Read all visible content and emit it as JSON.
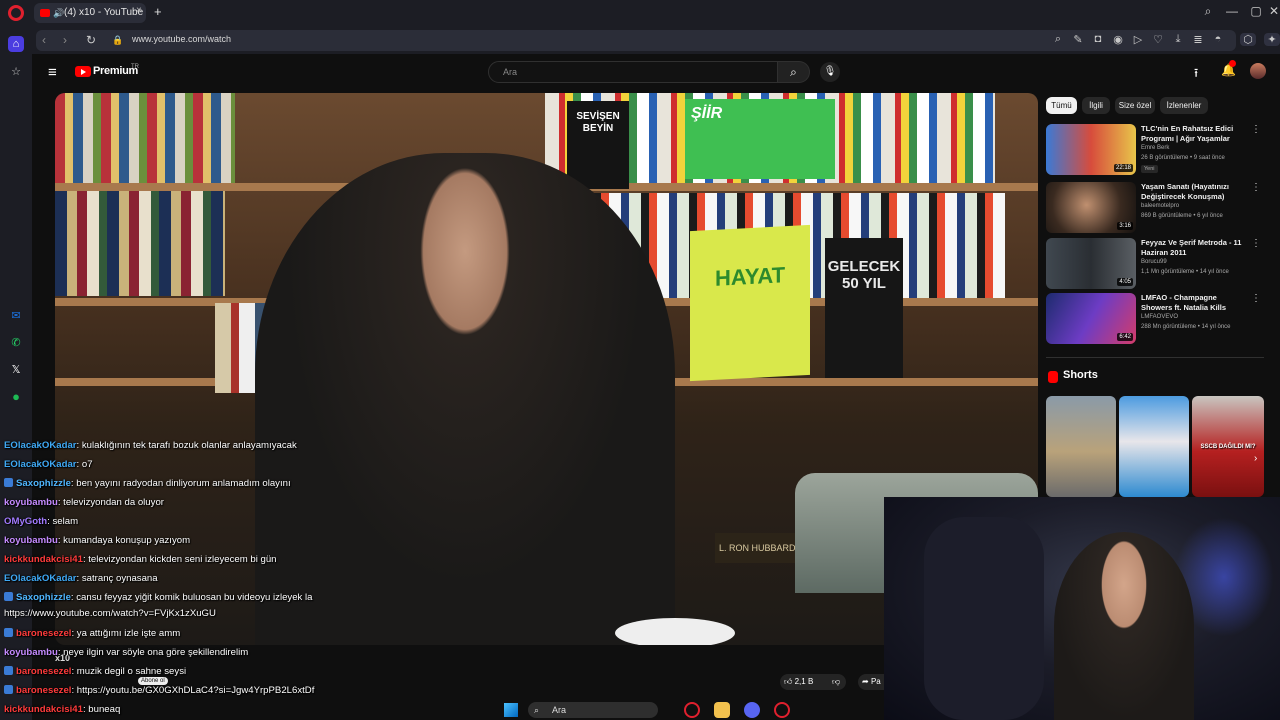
{
  "browser": {
    "tab_title": "(4) x10 - YouTube",
    "tab_audio_icon": "speaker-icon",
    "tab_close": "×",
    "new_tab": "+",
    "url": "www.youtube.com/watch",
    "window_controls": {
      "search": "⌕",
      "minimize": "—",
      "maximize": "▢",
      "close": "✕"
    }
  },
  "youtube": {
    "menu_glyph": "≡",
    "logo_text": "Premium",
    "logo_region": "TR",
    "search_placeholder": "Ara",
    "filter_chips": [
      "Tümü",
      "İlgili",
      "Size özel",
      "İzlenenler"
    ],
    "recommendations": [
      {
        "title": "TLC'nin En Rahatsız Edici Programı | Ağır Yaşamlar",
        "channel": "Emre Berk",
        "meta": "26 B görüntüleme • 9 saat önce",
        "badge": "Yeni",
        "duration": "22:18"
      },
      {
        "title": "Yaşam Sanatı (Hayatınızı Değiştirecek Konuşma)",
        "channel": "baleemotelpro",
        "meta": "869 B görüntüleme • 6 yıl önce",
        "duration": "3:16"
      },
      {
        "title": "Feyyaz Ve Şerif Metroda - 11 Haziran 2011",
        "channel": "Borucu99",
        "meta": "1,1 Mn görüntüleme • 14 yıl önce",
        "duration": "4:05"
      },
      {
        "title": "LMFAO - Champagne Showers ft. Natalia Kills",
        "channel": "LMFAOVEVO",
        "meta": "288 Mn görüntüleme • 14 yıl önce",
        "duration": "6:42"
      }
    ],
    "shorts_label": "Shorts",
    "shorts_items": [
      "short-1",
      "short-2",
      "short-3"
    ],
    "short_3_caption": "SSCB DAĞILDI MI?",
    "channel_name": "x10",
    "subscribe": "Abone ol",
    "like_count": "2,1 B",
    "share_label": "Pa"
  },
  "book_titles": {
    "b1": "SEVİŞEN BEYİN",
    "b2": "HAYAT",
    "b3": "GELECEK 50 YIL",
    "b4": "ŞİİR",
    "b5": "L. RON HUBBARD"
  },
  "chat": [
    {
      "user": "EOlacakOKadar",
      "text": ": kulaklığının tek tarafı bozuk olanlar anlayamıyacak",
      "color": "#3fa9f5",
      "platform": "none"
    },
    {
      "user": "EOlacakOKadar",
      "text": ": o7",
      "color": "#3fa9f5",
      "platform": "none"
    },
    {
      "user": "Saxophizzle",
      "text": ": ben yayını radyodan dinliyorum anlamadım olayını",
      "color": "#4fb6ff",
      "platform": "#3a7bd5"
    },
    {
      "user": "koyubambu",
      "text": ": televizyondan da oluyor",
      "color": "#c58bff",
      "platform": "none"
    },
    {
      "user": "OMyGoth",
      "text": ": selam",
      "color": "#a27bff",
      "platform": "none"
    },
    {
      "user": "koyubambu",
      "text": ": kumandaya konuşup yazıyom",
      "color": "#c58bff",
      "platform": "none"
    },
    {
      "user": "kickkundakcisi41",
      "text": ": televizyondan kickden seni izleyecem bi gün",
      "color": "#ff3b3b",
      "platform": "none"
    },
    {
      "user": "EOlacakOKadar",
      "text": ": satranç oynasana",
      "color": "#3fa9f5",
      "platform": "none"
    },
    {
      "user": "Saxophizzle",
      "text": ": cansu feyyaz yiğit komik buluosan bu videoyu izleyek la",
      "color": "#4fb6ff",
      "platform": "#3a7bd5"
    },
    {
      "user": "",
      "text": "https://www.youtube.com/watch?v=FVjKx1zXuGU",
      "color": "#ffffff",
      "platform": "none"
    },
    {
      "user": "baronesezel",
      "text": ": ya attığımı izle işte amm",
      "color": "#ff3b3b",
      "platform": "#3a7bd5"
    },
    {
      "user": "koyubambu",
      "text": ": neye ilgin var söyle ona göre şekillendirelim",
      "color": "#c58bff",
      "platform": "none"
    },
    {
      "user": "baronesezel",
      "text": ": muzik degil o sahne seysi",
      "color": "#ff3b3b",
      "platform": "#3a7bd5"
    },
    {
      "user": "baronesezel",
      "text": ": https://youtu.be/GX0GXhDLaC4?si=Jgw4YrpPB2L6xtDf",
      "color": "#ff3b3b",
      "platform": "#3a7bd5"
    },
    {
      "user": "kickkundakcisi41",
      "text": ": buneaq",
      "color": "#ff3b3b",
      "platform": "none"
    }
  ],
  "taskbar": {
    "search": "Ara"
  },
  "colors": {
    "youtube_red": "#ff0000",
    "background": "#0f0f0f",
    "chrome": "#1c1d24"
  }
}
